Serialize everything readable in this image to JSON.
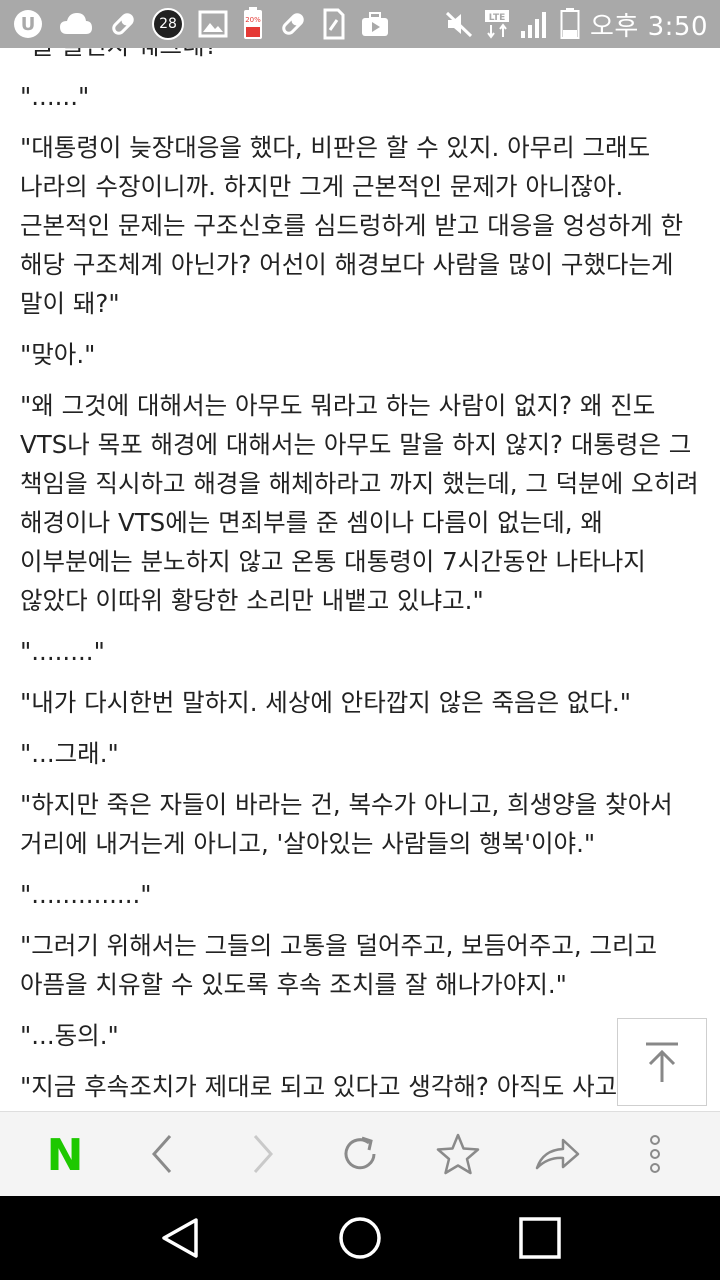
{
  "status_bar": {
    "notification_badge": "28",
    "battery_app_label": "20%",
    "network_label": "LTE",
    "time": "오후 3:50",
    "icons": [
      "u-plus-icon",
      "cloud-icon",
      "pill-icon",
      "badge-28-icon",
      "gallery-icon",
      "battery-app-icon",
      "pill-icon",
      "sim-icon",
      "media-icon",
      "mute-icon",
      "lte-icon",
      "signal-icon",
      "battery-icon"
    ]
  },
  "content": {
    "paragraphs": [
      "\"글 들신지 궤그네?",
      "\"......\"",
      "\"대통령이 늦장대응을 했다, 비판은 할 수 있지. 아무리 그래도 나라의 수장이니까. 하지만 그게 근본적인 문제가 아니잖아. 근본적인 문제는 구조신호를 심드렁하게 받고 대응을 엉성하게 한 해당 구조체계 아닌가? 어선이 해경보다 사람을 많이 구했다는게 말이 돼?\"",
      "\"맞아.\"",
      "\"왜 그것에 대해서는 아무도 뭐라고 하는 사람이 없지? 왜 진도 VTS나 목포 해경에 대해서는 아무도 말을 하지 않지? 대통령은 그 책임을 직시하고 해경을 해체하라고 까지 했는데, 그 덕분에 오히려 해경이나 VTS에는 면죄부를 준 셈이나 다름이 없는데, 왜 이부분에는 분노하지 않고 온통 대통령이 7시간동안 나타나지 않았다 이따위 황당한 소리만 내뱉고 있냐고.\"",
      "\"........\"",
      "\"내가 다시한번 말하지. 세상에 안타깝지 않은 죽음은 없다.\"",
      "\"...그래.\"",
      "\"하지만 죽은 자들이 바라는 건, 복수가 아니고, 희생양을 찾아서 거리에 내거는게 아니고, '살아있는 사람들의 행복'이야.\"",
      "\"..............\"",
      "\"그러기 위해서는 그들의 고통을 덜어주고, 보듬어주고, 그리고 아픔을 치유할 수 있도록 후속 조치를 잘 해나가야지.\"",
      "\"...동의.\"",
      "\"지금 후속조치가 제대로 되고 있다고 생각해? 아직도 사고"
    ]
  },
  "floating": {
    "scroll_top_icon": "arrow-up-to-top-icon"
  },
  "toolbar": {
    "brand_letter": "N",
    "brand_color": "#1ec800",
    "buttons": [
      "naver-home-icon",
      "back-icon",
      "forward-icon",
      "refresh-icon",
      "bookmark-star-icon",
      "share-icon",
      "more-vertical-icon"
    ]
  },
  "navbar": {
    "buttons": [
      "nav-back-icon",
      "nav-home-icon",
      "nav-recents-icon"
    ]
  }
}
